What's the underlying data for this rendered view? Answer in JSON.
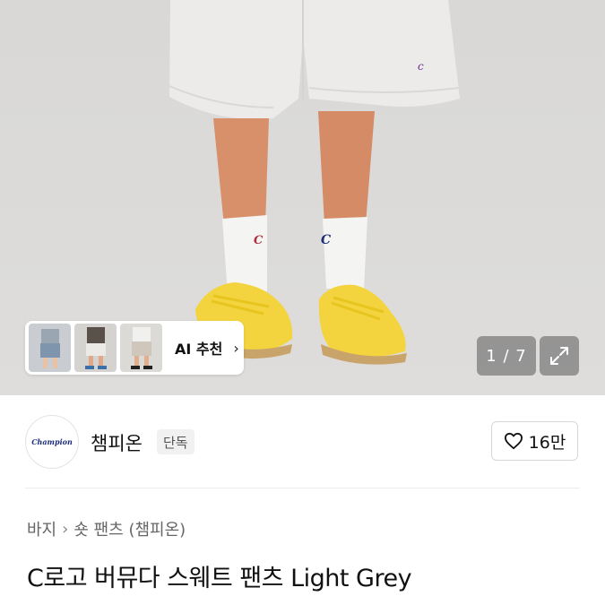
{
  "gallery": {
    "ai_recommend_label": "AI 추천",
    "counter": "1 / 7"
  },
  "brand": {
    "logo_text": "Champion",
    "name": "챔피온",
    "badge": "단독",
    "likes": "16만"
  },
  "breadcrumb": {
    "category": "바지",
    "subcategory": "숏 팬츠 (챔피온)"
  },
  "product": {
    "title": "C로고 버뮤다 스웨트 팬츠 Light Grey"
  },
  "colors": {
    "background": "#dddcda",
    "shorts": "#ecebea",
    "sneaker": "#f3d43f",
    "sole": "#c9a46a",
    "logo_blue": "#1c2d7a"
  }
}
